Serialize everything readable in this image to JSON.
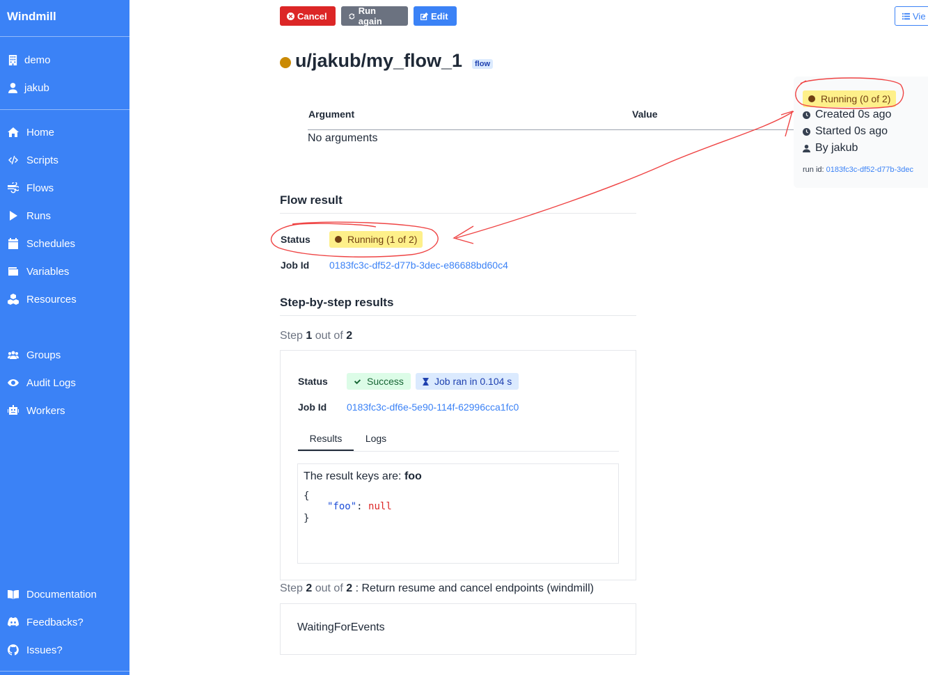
{
  "sidebar": {
    "brand": "Windmill",
    "workspace": "demo",
    "user": "jakub",
    "nav": [
      {
        "label": "Home",
        "icon": "home-icon"
      },
      {
        "label": "Scripts",
        "icon": "code-icon"
      },
      {
        "label": "Flows",
        "icon": "wind-icon"
      },
      {
        "label": "Runs",
        "icon": "play-icon"
      },
      {
        "label": "Schedules",
        "icon": "calendar-icon"
      },
      {
        "label": "Variables",
        "icon": "wallet-icon"
      },
      {
        "label": "Resources",
        "icon": "cubes-icon"
      }
    ],
    "admin": [
      {
        "label": "Groups",
        "icon": "users-icon"
      },
      {
        "label": "Audit Logs",
        "icon": "eye-icon"
      },
      {
        "label": "Workers",
        "icon": "robot-icon"
      }
    ],
    "footer": [
      {
        "label": "Documentation",
        "icon": "book-icon"
      },
      {
        "label": "Feedbacks?",
        "icon": "discord-icon"
      },
      {
        "label": "Issues?",
        "icon": "github-icon"
      }
    ]
  },
  "toolbar": {
    "cancel_label": "Cancel",
    "run_again_label": "Run again",
    "edit_label": "Edit",
    "view_label": "Vie"
  },
  "job": {
    "path": "u/jakub/my_flow_1",
    "kind_badge": "flow",
    "args_header_argument": "Argument",
    "args_header_value": "Value",
    "no_args": "No arguments"
  },
  "status_panel": {
    "status": "Running (0 of 2)",
    "created": "Created 0s ago",
    "started": "Started 0s ago",
    "by": "By jakub",
    "run_id_label": "run id:",
    "run_id": "0183fc3c-df52-d77b-3dec"
  },
  "flow_result": {
    "heading": "Flow result",
    "status_label": "Status",
    "status": "Running (1 of 2)",
    "job_id_label": "Job Id",
    "job_id": "0183fc3c-df52-d77b-3dec-e86688bd60c4"
  },
  "steps": {
    "heading": "Step-by-step results",
    "step1": {
      "word_step": "Step",
      "num": "1",
      "word_outof": "out of",
      "total": "2",
      "status_label": "Status",
      "status": "Success",
      "duration": "Job ran in 0.104 s",
      "job_id_label": "Job Id",
      "job_id": "0183fc3c-df6e-5e90-114f-62996cca1fc0",
      "tab_results": "Results",
      "tab_logs": "Logs",
      "result_keys_prefix": "The result keys are:",
      "result_keys": "foo",
      "code_open": "{",
      "code_key": "\"foo\"",
      "code_colon": ":",
      "code_value": "null",
      "code_close": "}"
    },
    "step2": {
      "word_step": "Step",
      "num": "2",
      "word_outof": "out of",
      "total": "2",
      "sep": ":",
      "description": "Return resume and cancel endpoints (windmill)",
      "state": "WaitingForEvents"
    }
  },
  "colors": {
    "sidebar": "#3b82f6",
    "running": "#ca8a04",
    "annotation": "#ef4444"
  }
}
